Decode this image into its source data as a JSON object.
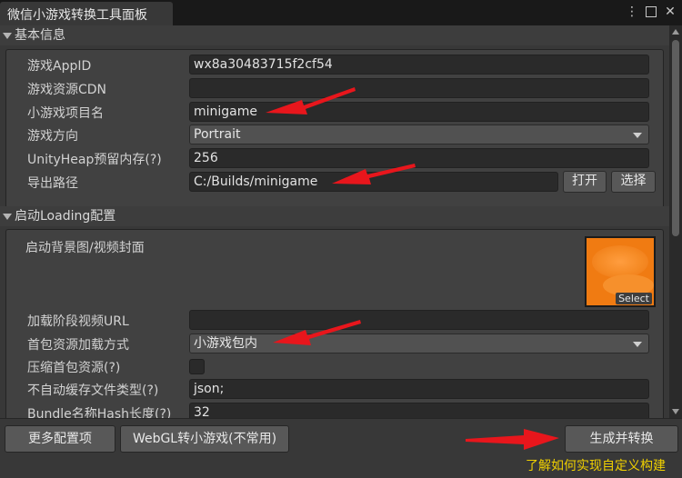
{
  "window": {
    "tab_title": "微信小游戏转换工具面板",
    "menu_icon": "kebab-menu-icon",
    "maximize_icon": "maximize-icon",
    "close_icon": "close-icon"
  },
  "basic_section": {
    "title": "基本信息",
    "appid": {
      "label": "游戏AppID",
      "value": "wx8a30483715f2cf54"
    },
    "cdn": {
      "label": "游戏资源CDN",
      "value": ""
    },
    "project_name": {
      "label": "小游戏项目名",
      "value": "minigame"
    },
    "orientation": {
      "label": "游戏方向",
      "value": "Portrait"
    },
    "heap": {
      "label": "UnityHeap预留内存(?)",
      "value": "256"
    },
    "export_path": {
      "label": "导出路径",
      "value": "C:/Builds/minigame",
      "open_label": "打开",
      "choose_label": "选择"
    }
  },
  "loading_section": {
    "title": "启动Loading配置",
    "cover": {
      "label": "启动背景图/视频封面",
      "select_label": "Select"
    },
    "video_url": {
      "label": "加载阶段视频URL",
      "value": ""
    },
    "first_pkg_mode": {
      "label": "首包资源加载方式",
      "value": "小游戏包内"
    },
    "compress_first": {
      "label": "压缩首包资源(?)",
      "checked": false
    },
    "no_cache_types": {
      "label": "不自动缓存文件类型(?)",
      "value": "json;"
    },
    "bundle_hash_len": {
      "label": "Bundle名称Hash长度(?)",
      "value": "32"
    }
  },
  "footer": {
    "more_config": "更多配置项",
    "webgl_convert": "WebGL转小游戏(不常用)",
    "build_convert": "生成并转换",
    "custom_build_link": "了解如何实现自定义构建"
  },
  "colors": {
    "annotation_arrow": "#e8161c",
    "link": "#f0d000",
    "cover_image": "#f07b12"
  }
}
